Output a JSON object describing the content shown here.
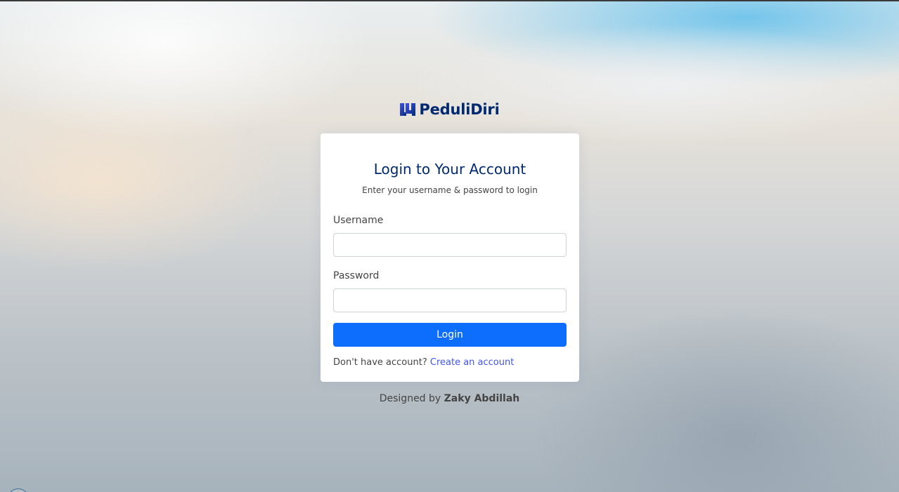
{
  "brand": {
    "name": "PeduliDiri",
    "logo_icon": "brand-logo-icon",
    "color": "#012970"
  },
  "login_card": {
    "title": "Login to Your Account",
    "subtitle": "Enter your username & password to login",
    "username": {
      "label": "Username",
      "value": "",
      "placeholder": ""
    },
    "password": {
      "label": "Password",
      "value": "",
      "placeholder": ""
    },
    "login_button": "Login",
    "signup_prompt": "Don't have account?",
    "signup_link": "Create an account"
  },
  "footer": {
    "designed_by": "Designed by",
    "designer": "Zaky Abdillah"
  },
  "colors": {
    "primary_button": "#0d6efd",
    "link": "#4154f1",
    "title": "#012970"
  }
}
